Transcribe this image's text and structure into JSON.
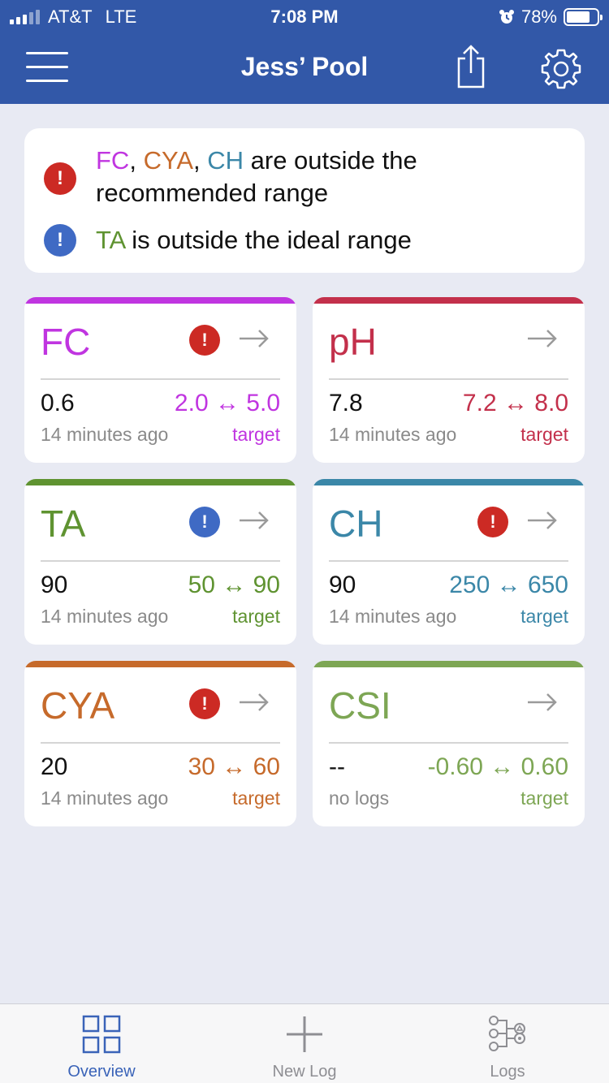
{
  "status_bar": {
    "carrier": "AT&T",
    "network": "LTE",
    "time": "7:08 PM",
    "battery": "78%",
    "battery_level": 0.78
  },
  "nav": {
    "title": "Jess’ Pool",
    "menu_icon": "hamburger-menu-icon",
    "share_icon": "share-icon",
    "settings_icon": "gear-icon"
  },
  "alerts": {
    "recommended": {
      "icon": "!",
      "color": "#cc2a24",
      "kw1": "FC",
      "sep1": ", ",
      "kw2": "CYA",
      "sep2": ", ",
      "kw3": "CH",
      "text": " are outside the recommended range"
    },
    "ideal": {
      "icon": "!",
      "color": "#3f6ac4",
      "kw1": "TA",
      "text": " is outside the ideal range"
    }
  },
  "cards": [
    {
      "name": "FC",
      "color": "#c035e0",
      "status": "!",
      "status_color": "#cc2a24",
      "value": "0.6",
      "range": "2.0 ↔ 5.0",
      "ago": "14 minutes ago",
      "target": "target"
    },
    {
      "name": "pH",
      "color": "#c3304b",
      "status": "",
      "status_color": "",
      "value": "7.8",
      "range": "7.2 ↔ 8.0",
      "ago": "14 minutes ago",
      "target": "target"
    },
    {
      "name": "TA",
      "color": "#5f9331",
      "status": "!",
      "status_color": "#3f6ac4",
      "value": "90",
      "range": "50 ↔ 90",
      "ago": "14 minutes ago",
      "target": "target"
    },
    {
      "name": "CH",
      "color": "#3b87a8",
      "status": "!",
      "status_color": "#cc2a24",
      "value": "90",
      "range": "250 ↔ 650",
      "ago": "14 minutes ago",
      "target": "target"
    },
    {
      "name": "CYA",
      "color": "#c66a2b",
      "status": "!",
      "status_color": "#cc2a24",
      "value": "20",
      "range": "30 ↔ 60",
      "ago": "14 minutes ago",
      "target": "target"
    },
    {
      "name": "CSI",
      "color": "#7da654",
      "status": "",
      "status_color": "",
      "value": "--",
      "range": "-0.60 ↔ 0.60",
      "ago": "no logs",
      "target": "target"
    }
  ],
  "tabs": [
    {
      "label": "Overview",
      "icon": "grid-icon",
      "color": "#3a63b8"
    },
    {
      "label": "New Log",
      "icon": "plus-icon",
      "color": "#8e8e93"
    },
    {
      "label": "Logs",
      "icon": "logs-tree-icon",
      "color": "#8e8e93"
    }
  ]
}
